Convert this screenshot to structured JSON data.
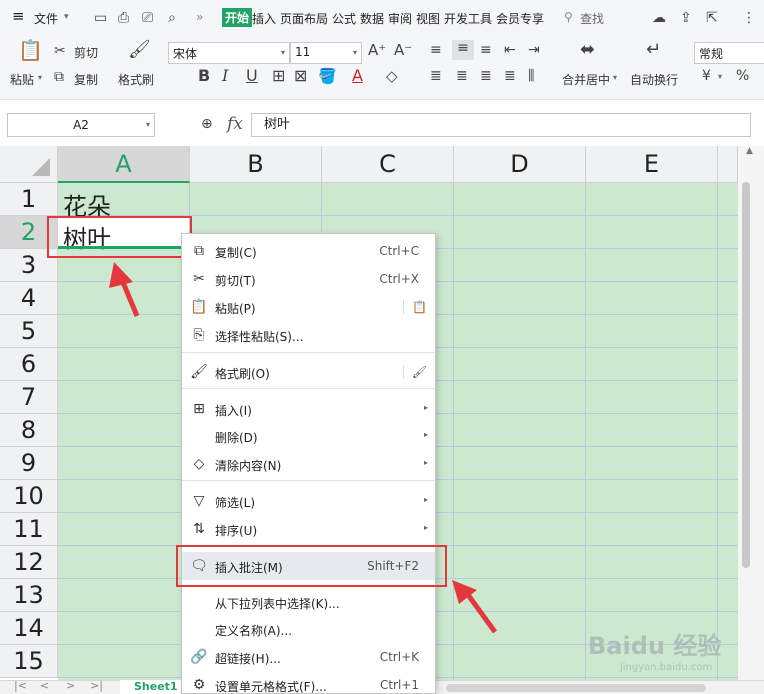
{
  "menubar": {
    "hamburger": "≡",
    "file": "文件",
    "items": [
      "开始",
      "插入",
      "页面布局",
      "公式",
      "数据",
      "审阅",
      "视图",
      "开发工具",
      "会员专享"
    ],
    "search": "查找"
  },
  "ribbon": {
    "paste": "粘贴",
    "cut": "剪切",
    "copy": "复制",
    "format_painter": "格式刷",
    "font_name": "宋体",
    "font_size": "11",
    "merge_center": "合并居中",
    "wrap_text": "自动换行",
    "number_format": "常规",
    "bold": "B",
    "italic": "I",
    "underline": "U",
    "currency": "¥",
    "percent": "%"
  },
  "formula": {
    "cell_ref": "A2",
    "fx": "fx",
    "value": "树叶"
  },
  "columns": [
    "A",
    "B",
    "C",
    "D",
    "E"
  ],
  "rows": [
    "1",
    "2",
    "3",
    "4",
    "5",
    "6",
    "7",
    "8",
    "9",
    "10",
    "11",
    "12",
    "13",
    "14",
    "15"
  ],
  "cells": {
    "a1": "花朵",
    "a2": "树叶"
  },
  "context_menu": {
    "copy": {
      "label": "复制(C)",
      "shortcut": "Ctrl+C"
    },
    "cut": {
      "label": "剪切(T)",
      "shortcut": "Ctrl+X"
    },
    "paste": {
      "label": "粘贴(P)"
    },
    "paste_special": {
      "label": "选择性粘贴(S)..."
    },
    "format_painter": {
      "label": "格式刷(O)"
    },
    "insert": {
      "label": "插入(I)"
    },
    "delete": {
      "label": "删除(D)"
    },
    "clear": {
      "label": "清除内容(N)"
    },
    "filter": {
      "label": "筛选(L)"
    },
    "sort": {
      "label": "排序(U)"
    },
    "insert_comment": {
      "label": "插入批注(M)",
      "shortcut": "Shift+F2"
    },
    "dropdown_pick": {
      "label": "从下拉列表中选择(K)..."
    },
    "define_name": {
      "label": "定义名称(A)..."
    },
    "hyperlink": {
      "label": "超链接(H)...",
      "shortcut": "Ctrl+K"
    },
    "format_cells": {
      "label": "设置单元格格式(F)...",
      "shortcut": "Ctrl+1"
    }
  },
  "sheet_tab": "Sheet1",
  "watermark": {
    "brand": "Baidu 经验",
    "url": "jingyan.baidu.com"
  },
  "colors": {
    "accent": "#21a366",
    "cell_bg": "#cce8cf",
    "highlight": "#e3393c"
  }
}
